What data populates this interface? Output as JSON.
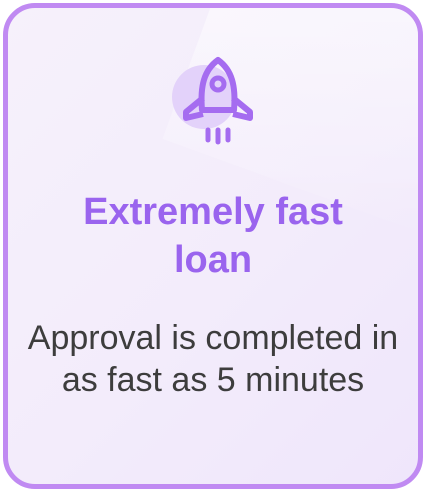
{
  "card": {
    "icon": "rocket-icon",
    "title": "Extremely fast loan",
    "description": "Approval is completed in as fast as 5 minutes",
    "colors": {
      "accent": "#9a64ee",
      "border": "#c08af2",
      "text": "#3d3d3d"
    }
  }
}
